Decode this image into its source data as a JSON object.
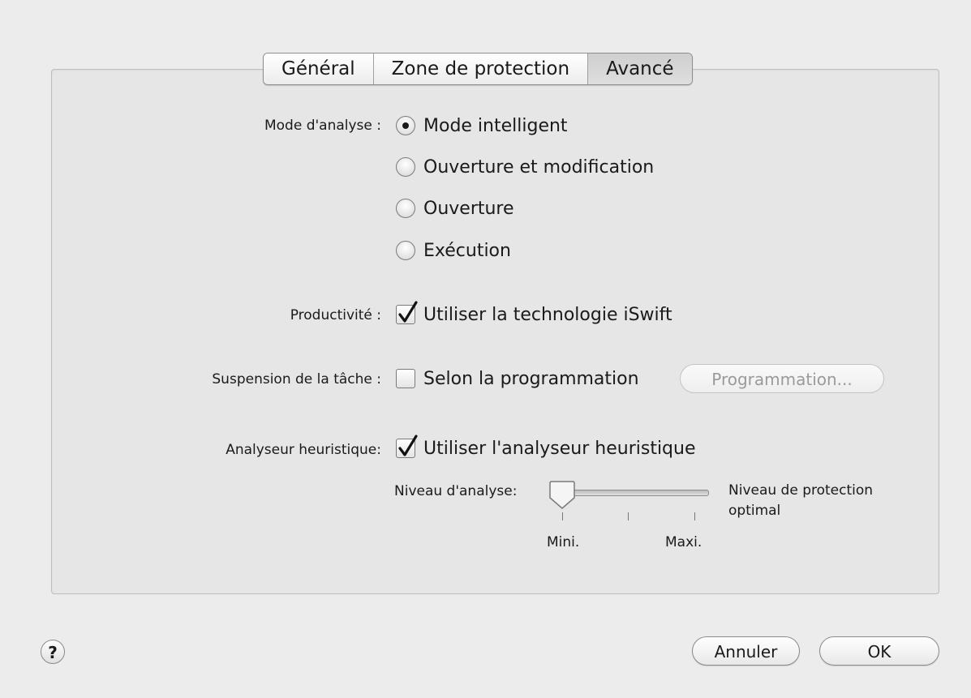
{
  "tabs": [
    "Général",
    "Zone de protection",
    "Avancé"
  ],
  "active_tab": "Avancé",
  "scan_mode": {
    "label": "Mode d'analyse :",
    "options": [
      "Mode intelligent",
      "Ouverture et modification",
      "Ouverture",
      "Exécution"
    ],
    "selected": "Mode intelligent"
  },
  "productivity": {
    "label": "Productivité :",
    "checkbox": "Utiliser la technologie iSwift",
    "checked": true
  },
  "task_suspension": {
    "label": "Suspension de la tâche :",
    "checkbox": "Selon la programmation",
    "checked": false,
    "button": "Programmation..."
  },
  "heuristic": {
    "label": "Analyseur heuristique:",
    "checkbox": "Utiliser l'analyseur heuristique",
    "checked": true,
    "level_label": "Niveau d'analyse:",
    "level_value": 0,
    "min_label": "Mini.",
    "max_label": "Maxi.",
    "description": [
      "Niveau de protection",
      "optimal"
    ]
  },
  "footer": {
    "help_icon": "?",
    "cancel": "Annuler",
    "ok": "OK"
  }
}
